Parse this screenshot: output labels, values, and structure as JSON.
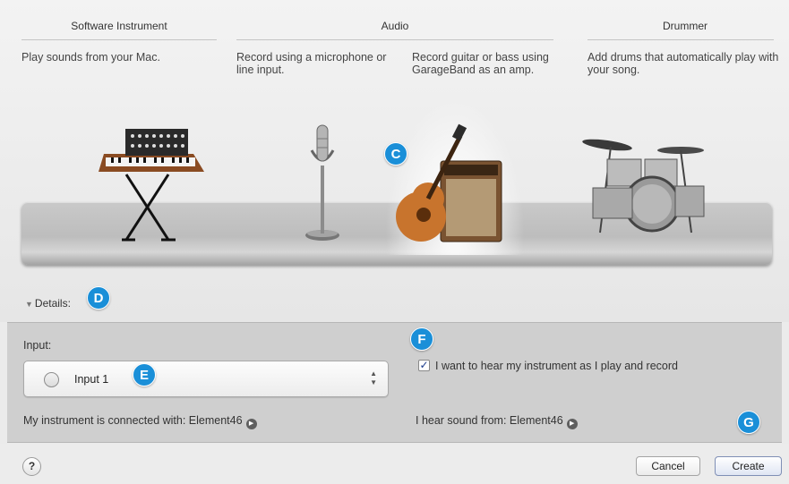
{
  "categories": [
    {
      "title": "Software Instrument",
      "descriptions": [
        "Play sounds from your Mac."
      ]
    },
    {
      "title": "Audio",
      "descriptions": [
        "Record using a microphone or line input.",
        "Record guitar or bass using GarageBand as an amp."
      ]
    },
    {
      "title": "Drummer",
      "descriptions": [
        "Add drums that automatically play with your song."
      ]
    }
  ],
  "callouts": {
    "c": "C",
    "d": "D",
    "e": "E",
    "f": "F",
    "g": "G"
  },
  "details": {
    "toggle_label": "Details:",
    "input_label": "Input:",
    "input_value": "Input 1",
    "monitor_checkbox_label": "I want to hear my instrument as I play and record",
    "monitor_checked": true,
    "connected_with": "My instrument is connected with: Element46",
    "hear_sound_from": "I hear sound from: Element46"
  },
  "footer": {
    "help_label": "?",
    "cancel_label": "Cancel",
    "create_label": "Create"
  },
  "icons": [
    "keyboard-synth-icon",
    "microphone-icon",
    "guitar-amp-icon",
    "drum-kit-icon",
    "go-arrow-icon",
    "help-icon",
    "stepper-icon"
  ]
}
